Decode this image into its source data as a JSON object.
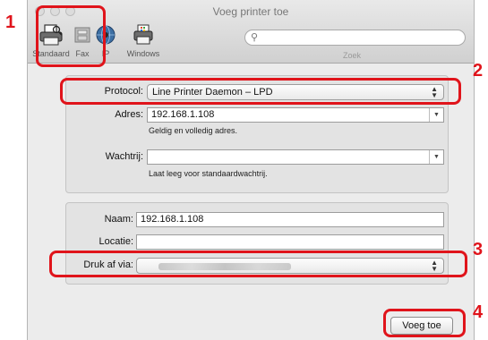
{
  "window": {
    "title": "Voeg printer toe"
  },
  "toolbar": {
    "items": [
      {
        "label": "Standaard",
        "icon": "printer-icon"
      },
      {
        "label": "Fax",
        "icon": "fax-icon"
      },
      {
        "label": "IP",
        "icon": "globe-icon"
      },
      {
        "label": "Windows",
        "icon": "windows-printer-icon"
      }
    ],
    "search": {
      "value": "",
      "label": "Zoek"
    }
  },
  "form": {
    "protocol": {
      "label": "Protocol:",
      "value": "Line Printer Daemon – LPD"
    },
    "address": {
      "label": "Adres:",
      "value": "192.168.1.108",
      "hint": "Geldig en volledig adres."
    },
    "queue": {
      "label": "Wachtrij:",
      "value": "",
      "hint": "Laat leeg voor standaardwachtrij."
    },
    "name": {
      "label": "Naam:",
      "value": "192.168.1.108"
    },
    "location": {
      "label": "Locatie:",
      "value": ""
    },
    "driver": {
      "label": "Druk af via:",
      "value": ""
    }
  },
  "actions": {
    "add_label": "Voeg toe"
  },
  "callouts": [
    "1",
    "2",
    "3",
    "4"
  ],
  "colors": {
    "callout": "#e0141b"
  }
}
